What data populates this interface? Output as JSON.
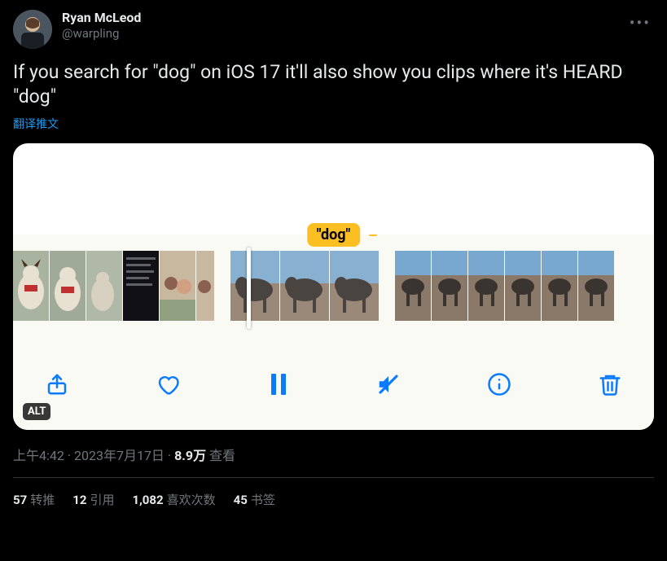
{
  "author": {
    "display_name": "Ryan McLeod",
    "handle": "@warpling"
  },
  "tweet_text": "If you search for \"dog\" on iOS 17 it'll also show you clips where it's HEARD \"dog\"",
  "translate_link": "翻译推文",
  "media": {
    "search_label": "\"dog\"",
    "alt_badge": "ALT"
  },
  "meta": {
    "time": "上午4:42",
    "date": "2023年7月17日",
    "views_count": "8.9万",
    "views_label": "查看"
  },
  "stats": {
    "retweets_count": "57",
    "retweets_label": "转推",
    "quotes_count": "12",
    "quotes_label": "引用",
    "likes_count": "1,082",
    "likes_label": "喜欢次数",
    "bookmarks_count": "45",
    "bookmarks_label": "书签"
  }
}
